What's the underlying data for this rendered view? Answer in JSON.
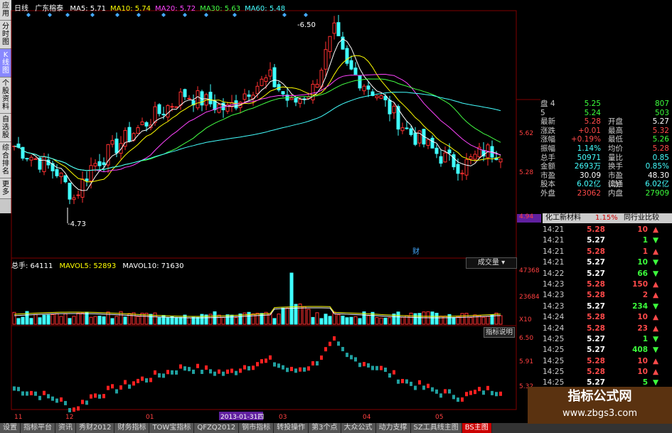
{
  "left_tabs": [
    "应用",
    "分时图",
    "K线图",
    "个股资料",
    "自选股",
    "综合排名",
    "更多"
  ],
  "header": {
    "period": "日线",
    "stock_name": "广东榕泰",
    "ma": [
      {
        "label": "MA5: 5.71",
        "color": "#ffffff"
      },
      {
        "label": "MA10: 5.74",
        "color": "#ffff00"
      },
      {
        "label": "MA20: 5.72",
        "color": "#ff44ff"
      },
      {
        "label": "MA30: 5.63",
        "color": "#44ff44"
      },
      {
        "label": "MA60: 5.48",
        "color": "#44ffff"
      }
    ]
  },
  "price_labels": {
    "high": "6.50",
    "low": "4.73"
  },
  "price_axis": [
    "5.62",
    "5.28",
    "4.94"
  ],
  "volume": {
    "total_label": "总手: 64111",
    "mavol5": "MAVOL5: 52893",
    "mavol10": "MAVOL10: 71630",
    "button": "成交量",
    "axis": [
      "47368",
      "23684",
      "X10"
    ]
  },
  "indicator": {
    "button": "指标说明",
    "axis": [
      "6.50",
      "5.91",
      "5.32"
    ]
  },
  "x_axis": [
    "11",
    "12",
    "01",
    "2013-01-31四",
    "03",
    "04",
    "05"
  ],
  "cai_mark": "财",
  "quote_rows": [
    {
      "k1": "盘",
      "v1": "4",
      "v1b": "5.25",
      "v2": "807"
    },
    {
      "k1": "",
      "v1": "5",
      "v1b": "5.24",
      "v2": "503"
    }
  ],
  "quote": [
    {
      "k1": "最新",
      "v1": "5.28",
      "c1": "red",
      "k2": "开盘",
      "v2": "5.27",
      "c2": "white"
    },
    {
      "k1": "涨跌",
      "v1": "+0.01",
      "c1": "red",
      "k2": "最高",
      "v2": "5.32",
      "c2": "red"
    },
    {
      "k1": "涨幅",
      "v1": "+0.19%",
      "c1": "red",
      "k2": "最低",
      "v2": "5.26",
      "c2": "green"
    },
    {
      "k1": "振幅",
      "v1": "1.14%",
      "c1": "cyan",
      "k2": "均价",
      "v2": "5.28",
      "c2": "red"
    },
    {
      "k1": "总手",
      "v1": "50971",
      "c1": "cyan",
      "k2": "量比",
      "v2": "0.85",
      "c2": "cyan"
    },
    {
      "k1": "金额",
      "v1": "2693万",
      "c1": "cyan",
      "k2": "换手",
      "v2": "0.85%",
      "c2": "cyan"
    },
    {
      "k1": "市盈",
      "v1": "30.09",
      "c1": "white",
      "k2": "市盈(动)",
      "v2": "48.30",
      "c2": "white"
    },
    {
      "k1": "股本",
      "v1": "6.02亿",
      "c1": "cyan",
      "k2": "流通",
      "v2": "6.02亿",
      "c2": "cyan"
    },
    {
      "k1": "外盘",
      "v1": "23062",
      "c1": "red",
      "k2": "内盘",
      "v2": "27909",
      "c2": "green"
    }
  ],
  "industry": {
    "name": "化工新材料",
    "change": "1.15%",
    "compare": "同行业比较"
  },
  "trades": [
    {
      "t": "14:21",
      "p": "5.28",
      "pc": "red",
      "v": "10",
      "d": "up"
    },
    {
      "t": "14:21",
      "p": "5.27",
      "pc": "white",
      "v": "1",
      "d": "down"
    },
    {
      "t": "14:21",
      "p": "5.28",
      "pc": "red",
      "v": "1",
      "d": "up"
    },
    {
      "t": "14:21",
      "p": "5.27",
      "pc": "white",
      "v": "10",
      "d": "down"
    },
    {
      "t": "14:22",
      "p": "5.27",
      "pc": "white",
      "v": "66",
      "d": "down"
    },
    {
      "t": "14:23",
      "p": "5.28",
      "pc": "red",
      "v": "150",
      "d": "up"
    },
    {
      "t": "14:23",
      "p": "5.28",
      "pc": "red",
      "v": "2",
      "d": "up"
    },
    {
      "t": "14:23",
      "p": "5.27",
      "pc": "white",
      "v": "234",
      "d": "down"
    },
    {
      "t": "14:24",
      "p": "5.28",
      "pc": "red",
      "v": "10",
      "d": "up"
    },
    {
      "t": "14:24",
      "p": "5.28",
      "pc": "red",
      "v": "23",
      "d": "up"
    },
    {
      "t": "14:25",
      "p": "5.27",
      "pc": "white",
      "v": "1",
      "d": "down"
    },
    {
      "t": "14:25",
      "p": "5.27",
      "pc": "white",
      "v": "408",
      "d": "down"
    },
    {
      "t": "14:25",
      "p": "5.28",
      "pc": "red",
      "v": "10",
      "d": "up"
    },
    {
      "t": "14:25",
      "p": "5.28",
      "pc": "red",
      "v": "10",
      "d": "up"
    },
    {
      "t": "14:25",
      "p": "5.27",
      "pc": "white",
      "v": "5",
      "d": "down"
    }
  ],
  "bottom_tabs": [
    "设置",
    "指标平台",
    "资讯",
    "秀财2012",
    "财务指标",
    "TOW宝指标",
    "QFZQ2012",
    "钢市指标",
    "转投操作",
    "第3个点",
    "大众公式",
    "动力支撑",
    "SZ工具线主图",
    "BS主图"
  ],
  "watermark": {
    "line1": "指标公式网",
    "line2": "www.zbgs3.com"
  }
}
